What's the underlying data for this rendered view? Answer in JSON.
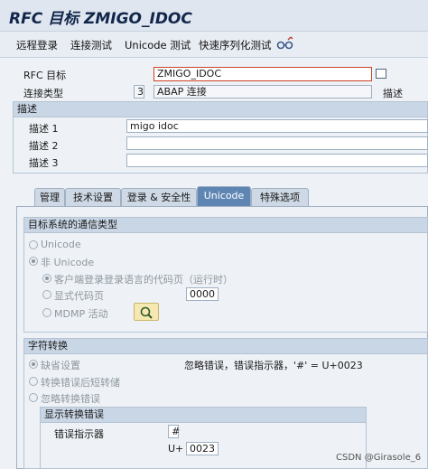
{
  "window": {
    "title": "RFC 目标 ZMIGO_IDOC"
  },
  "toolbar": {
    "items": [
      "远程登录",
      "连接测试",
      "Unicode 测试",
      "快速序列化测试"
    ],
    "icon": "glasses-icon"
  },
  "header": {
    "rfc_label": "RFC 目标",
    "rfc_value": "ZMIGO_IDOC",
    "conn_type_label": "连接类型",
    "conn_type_code": "3",
    "conn_type_text": "ABAP 连接",
    "desc_link": "描述"
  },
  "description": {
    "title": "描述",
    "rows": [
      {
        "label": "描述 1",
        "value": "migo idoc"
      },
      {
        "label": "描述 2",
        "value": ""
      },
      {
        "label": "描述 3",
        "value": ""
      }
    ]
  },
  "tabs": [
    "管理",
    "技术设置",
    "登录 & 安全性",
    "Unicode",
    "特殊选项"
  ],
  "active_tab": "Unicode",
  "comm_type": {
    "title": "目标系统的通信类型",
    "unicode": "Unicode",
    "non_unicode": "非 Unicode",
    "client_codepage": "客户端登录登录语言的代码页（运行时）",
    "explicit_codepage": "显式代码页",
    "codepage_value": "0000",
    "mdmp": "MDMP 活动"
  },
  "char_conv": {
    "title": "字符转换",
    "default": "缺省设置",
    "default_desc": "忽略错误，错误指示器，'#' = U+0023",
    "report_after": "转换错误后短转储",
    "ignore_errors": "忽略转换错误",
    "display_group_title": "显示转换错误",
    "error_indicator_label": "错误指示器",
    "error_indicator_value": "#",
    "u_plus_label": "U+",
    "u_plus_value": "0023"
  },
  "watermark": "CSDN @Girasole_6"
}
